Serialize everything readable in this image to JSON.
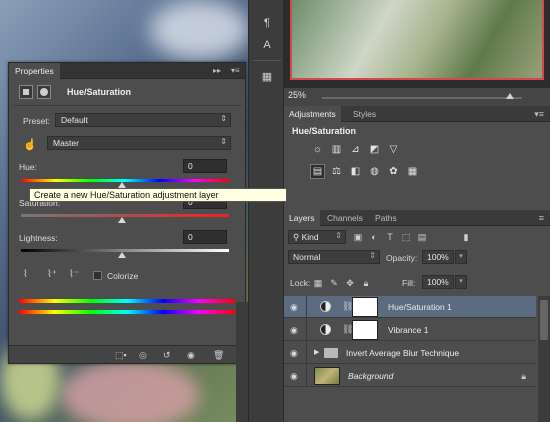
{
  "properties": {
    "tab_label": "Properties",
    "title": "Hue/Saturation",
    "preset_label": "Preset:",
    "preset_value": "Default",
    "channel_value": "Master",
    "hue_label": "Hue:",
    "hue_value": "0",
    "saturation_label": "Saturation:",
    "saturation_value": "0",
    "lightness_label": "Lightness:",
    "lightness_value": "0",
    "colorize_label": "Colorize"
  },
  "navigator": {
    "zoom": "25%"
  },
  "adjustments": {
    "tabs": [
      "Adjustments",
      "Styles"
    ],
    "title": "Hue/Saturation",
    "tooltip": "Create a new Hue/Saturation adjustment layer"
  },
  "layers": {
    "tabs": [
      "Layers",
      "Channels",
      "Paths"
    ],
    "filter_kind": "Kind",
    "blend_mode": "Normal",
    "opacity_label": "Opacity:",
    "opacity_value": "100%",
    "lock_label": "Lock:",
    "fill_label": "Fill:",
    "fill_value": "100%",
    "items": [
      {
        "name": "Hue/Saturation 1"
      },
      {
        "name": "Vibrance 1"
      },
      {
        "name": "Invert Average Blur Technique"
      },
      {
        "name": "Background"
      }
    ]
  }
}
